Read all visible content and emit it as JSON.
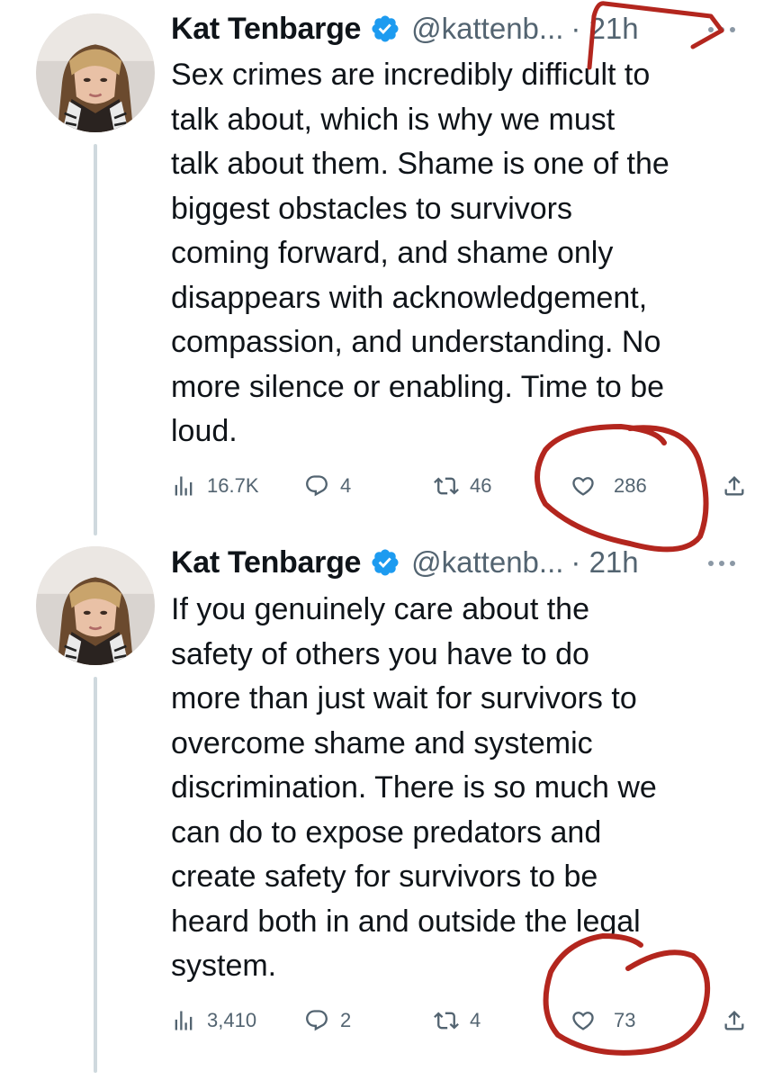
{
  "colors": {
    "text": "#0f1419",
    "muted": "#536471",
    "verified": "#1d9bf0",
    "annotation": "#b3261e",
    "thread_line": "#cfd9de"
  },
  "tweets": [
    {
      "author_name": "Kat Tenbarge",
      "handle": "@kattenb...",
      "time": "· 21h",
      "text": "Sex crimes are incredibly difficult to\ntalk about, which is why we must\ntalk about them. Shame is one of the\nbiggest obstacles to survivors\ncoming forward, and shame only\ndisappears with acknowledgement,\ncompassion, and understanding. No\nmore silence or enabling. Time to be\nloud.",
      "views": "16.7K",
      "replies": "4",
      "retweets": "46",
      "likes": "286"
    },
    {
      "author_name": "Kat Tenbarge",
      "handle": "@kattenb...",
      "time": "· 21h",
      "text": "If you genuinely care about the\nsafety of others you have to do\nmore than just wait for survivors to\novercome shame and systemic\ndiscrimination. There is so much we\ncan do to expose predators and\ncreate safety for survivors to be\nheard both in and outside the legal\nsystem.",
      "views": "3,410",
      "replies": "2",
      "retweets": "4",
      "likes": "73"
    }
  ],
  "icons": [
    "verified-badge-icon",
    "more-icon",
    "views-icon",
    "reply-icon",
    "retweet-icon",
    "like-icon",
    "share-icon"
  ]
}
